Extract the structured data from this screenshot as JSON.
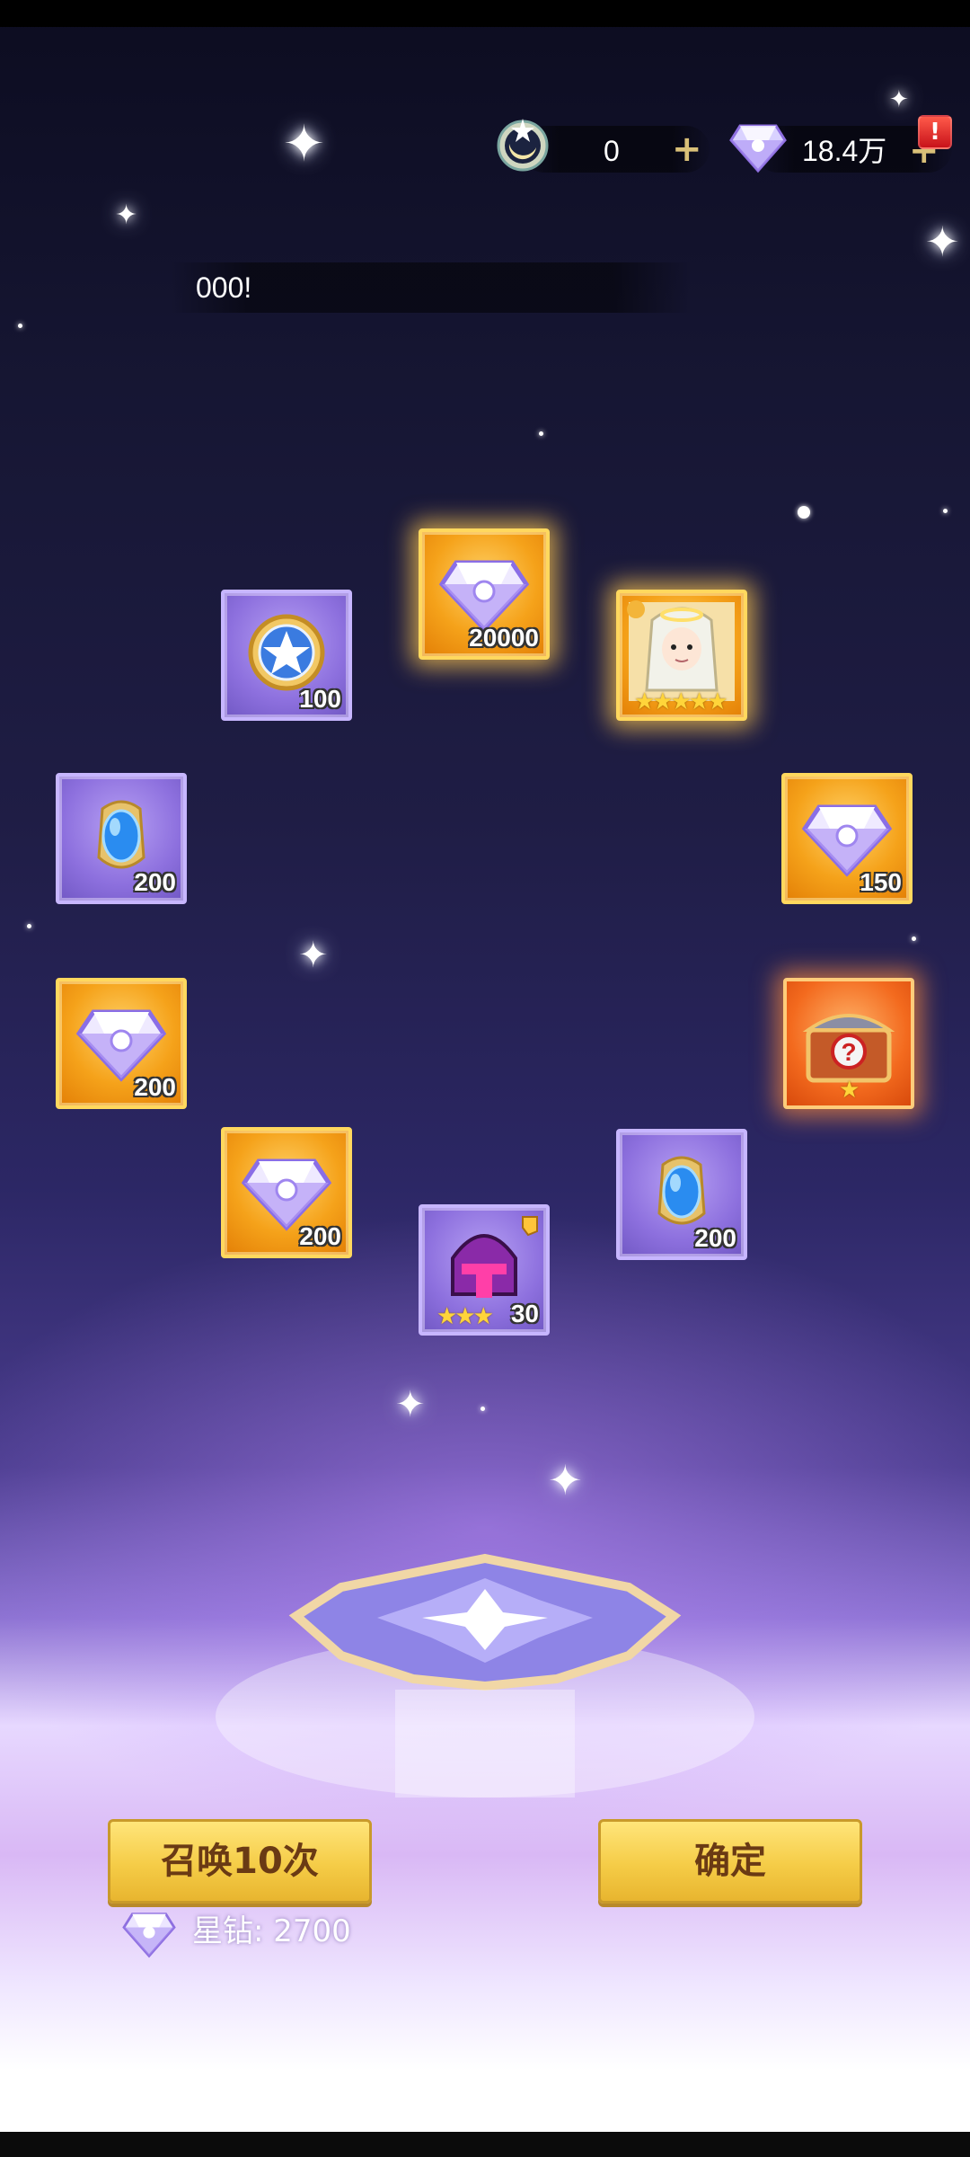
{
  "resources": {
    "moon_currency": "0",
    "diamond_currency": "18.4万",
    "alert_badge": "!"
  },
  "banner_text": "000!",
  "rewards": [
    {
      "item": "diamond",
      "count": "20000",
      "rarity": "gold"
    },
    {
      "item": "star-coin",
      "count": "100",
      "rarity": "purple"
    },
    {
      "item": "hero",
      "stars": "★★★★★",
      "rarity": "gold"
    },
    {
      "item": "blue-gem",
      "count": "200",
      "rarity": "purple"
    },
    {
      "item": "diamond",
      "count": "150",
      "rarity": "gold"
    },
    {
      "item": "diamond",
      "count": "200",
      "rarity": "gold"
    },
    {
      "item": "mystery-chest",
      "stars": "★",
      "rarity": "red"
    },
    {
      "item": "diamond",
      "count": "200",
      "rarity": "gold"
    },
    {
      "item": "blue-gem",
      "count": "200",
      "rarity": "purple"
    },
    {
      "item": "helmet",
      "count": "30",
      "stars": "★★★",
      "rarity": "purple"
    }
  ],
  "actions": {
    "summon_label": "召唤10次",
    "confirm_label": "确定",
    "cost_label": "星钻: 2700"
  }
}
